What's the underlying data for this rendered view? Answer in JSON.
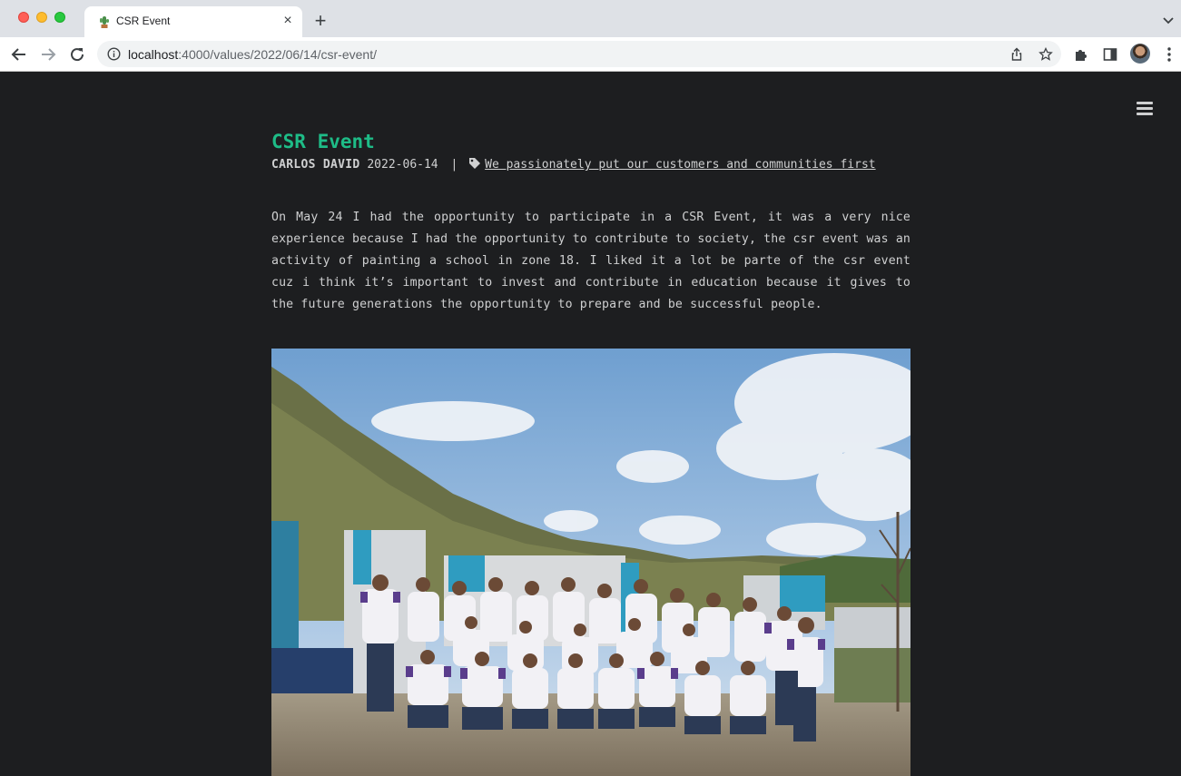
{
  "browser": {
    "tab_title": "CSR Event",
    "tab_close": "×",
    "new_tab": "+",
    "url_host": "localhost",
    "url_path": ":4000/values/2022/06/14/csr-event/"
  },
  "post": {
    "title": "CSR Event",
    "author": "CARLOS DAVID",
    "date": "2022-06-14",
    "separator": "|",
    "tag": "We passionately put our customers and communities first",
    "body": "On May 24 I had the opportunity to participate in a CSR Event, it was a very nice experience because I had the opportunity to contribute to society, the csr event was an activity of painting a school in zone 18. I liked it a lot be parte of the csr event cuz i think it’s important to invest and contribute in education because it gives to the future generations the opportunity to prepare and be successful people."
  },
  "colors": {
    "page_bg": "#1d1e20",
    "title_green": "#1ebc87",
    "text": "#cfd0d1"
  }
}
